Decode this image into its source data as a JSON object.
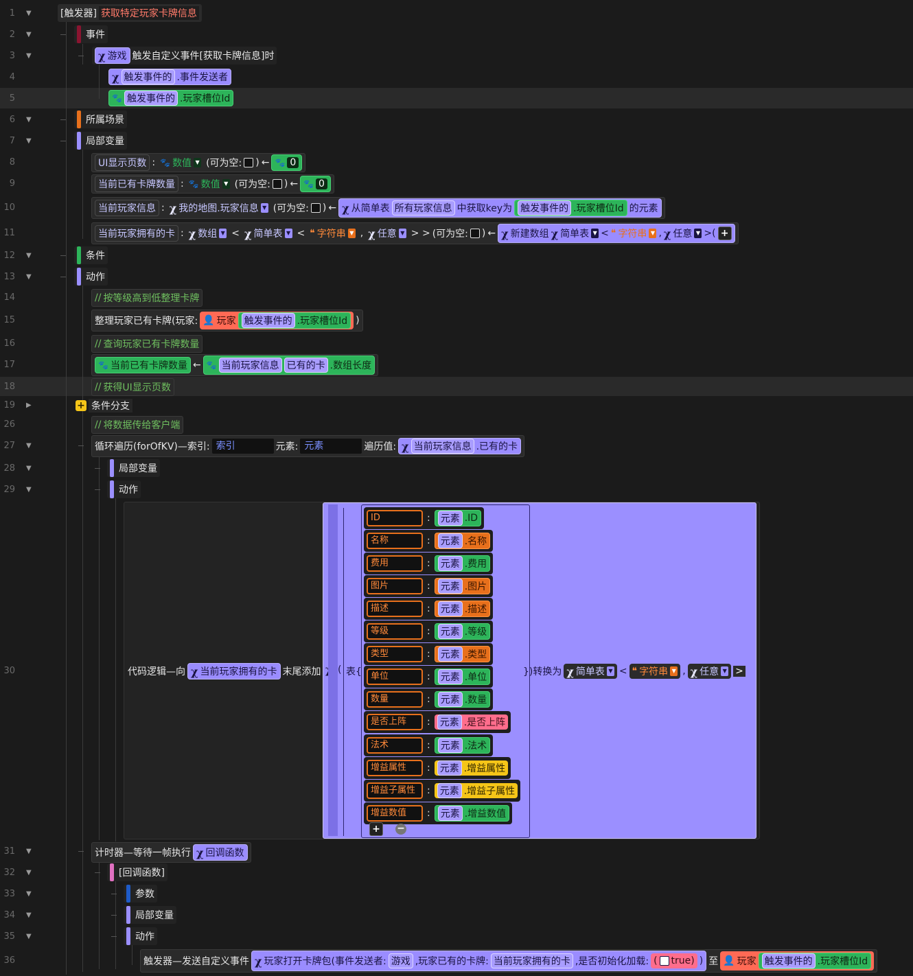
{
  "lines": {
    "l1": {
      "num": "1",
      "prefix": "[触发器]",
      "name": "获取特定玩家卡牌信息"
    },
    "l2": {
      "num": "2",
      "label": "事件"
    },
    "l3": {
      "num": "3",
      "game": "游戏",
      "text": "触发自定义事件[获取卡牌信息]时"
    },
    "l4": {
      "num": "4",
      "a": "触发事件的",
      "b": ".事件发送者"
    },
    "l5": {
      "num": "5",
      "a": "触发事件的",
      "b": ".玩家槽位Id"
    },
    "l6": {
      "num": "6",
      "label": "所属场景"
    },
    "l7": {
      "num": "7",
      "label": "局部变量"
    },
    "l8": {
      "num": "8",
      "var": "UI显示页数",
      "colon": ":",
      "type": "数值",
      "nullable": "(可为空:",
      "close": ")",
      "arrow": "←",
      "value": "0"
    },
    "l9": {
      "num": "9",
      "var": "当前已有卡牌数量",
      "colon": ":",
      "type": "数值",
      "nullable": "(可为空:",
      "close": ")",
      "arrow": "←",
      "value": "0"
    },
    "l10": {
      "num": "10",
      "var": "当前玩家信息",
      "colon": ":",
      "type": "我的地图.玩家信息",
      "nullable": "(可为空:",
      "close": ")",
      "arrow": "←",
      "from": "从简单表",
      "table": "所有玩家信息",
      "get": "中获取key为",
      "a": "触发事件的",
      "b": ".玩家槽位Id",
      "tail": "的元素"
    },
    "l11": {
      "num": "11",
      "var": "当前玩家拥有的卡",
      "colon": ":",
      "type": "数组",
      "lt": "<",
      "simple": "简单表",
      "lt2": "<",
      "str": "字符串",
      "comma": ",",
      "any": "任意",
      "gt": "> >",
      "nullable": "(可为空:",
      "close": ")",
      "arrow": "←",
      "newarr": "新建数组",
      "simple2": "简单表",
      "lt3": "<",
      "str2": "字符串",
      "comma2": ",",
      "any2": "任意",
      "gt2": ">(",
      "plus": "+"
    },
    "l12": {
      "num": "12",
      "label": "条件"
    },
    "l13": {
      "num": "13",
      "label": "动作"
    },
    "l14": {
      "num": "14",
      "comment": "按等级高到低整理卡牌"
    },
    "l15": {
      "num": "15",
      "text": "整理玩家已有卡牌(玩家:",
      "player": "玩家",
      "a": "触发事件的",
      "b": ".玩家槽位Id",
      "close": ")"
    },
    "l16": {
      "num": "16",
      "comment": "查询玩家已有卡牌数量"
    },
    "l17": {
      "num": "17",
      "var": "当前已有卡牌数量",
      "arrow": "←",
      "a": "当前玩家信息",
      "b": "已有的卡",
      "c": ".数组长度"
    },
    "l18": {
      "num": "18",
      "comment": "获得UI显示页数"
    },
    "l19": {
      "num": "19",
      "label": "条件分支"
    },
    "l26": {
      "num": "26",
      "comment": "将数据传给客户端"
    },
    "l27": {
      "num": "27",
      "text": "循环遍历(forOfKV)—索引:",
      "idx": "索引",
      "elem_label": "元素:",
      "elem": "元素",
      "iter": "遍历值:",
      "a": "当前玩家信息",
      "b": ".已有的卡"
    },
    "l28": {
      "num": "28",
      "label": "局部变量"
    },
    "l29": {
      "num": "29",
      "label": "动作"
    },
    "l30": {
      "num": "30",
      "text": "代码逻辑—向",
      "arr": "当前玩家拥有的卡",
      "append": "末尾添加",
      "paren": "(",
      "table": "表{",
      "close": "})转换为",
      "simple": "简单表",
      "lt": "<",
      "str": "字符串",
      "comma": ",",
      "any": "任意",
      "gt": ">"
    },
    "l31": {
      "num": "31",
      "text": "计时器—等待一帧执行",
      "cb": "回调函数"
    },
    "l32": {
      "num": "32",
      "label": "[回调函数]"
    },
    "l33": {
      "num": "33",
      "label": "参数"
    },
    "l34": {
      "num": "34",
      "label": "局部变量"
    },
    "l35": {
      "num": "35",
      "label": "动作"
    },
    "l36": {
      "num": "36",
      "text": "触发器—发送自定义事件",
      "evt": "玩家打开卡牌包(事件发送者:",
      "game": "游戏",
      ",cards": ",玩家已有的卡牌:",
      "arr": "当前玩家拥有的卡",
      "init": ",是否初始化加载:",
      "true": "true)",
      "close": ")",
      "to": "至",
      "player": "玩家",
      "a": "触发事件的",
      "b": ".玩家槽位Id"
    }
  },
  "table_fields": [
    {
      "key": "ID",
      "elem": "元素",
      "field": ".ID",
      "color": "green"
    },
    {
      "key": "名称",
      "elem": "元素",
      "field": ".名称",
      "color": "orange"
    },
    {
      "key": "费用",
      "elem": "元素",
      "field": ".费用",
      "color": "green"
    },
    {
      "key": "图片",
      "elem": "元素",
      "field": ".图片",
      "color": "orange"
    },
    {
      "key": "描述",
      "elem": "元素",
      "field": ".描述",
      "color": "orange"
    },
    {
      "key": "等级",
      "elem": "元素",
      "field": ".等级",
      "color": "green"
    },
    {
      "key": "类型",
      "elem": "元素",
      "field": ".类型",
      "color": "orange"
    },
    {
      "key": "单位",
      "elem": "元素",
      "field": ".单位",
      "color": "green"
    },
    {
      "key": "数量",
      "elem": "元素",
      "field": ".数量",
      "color": "green"
    },
    {
      "key": "是否上阵",
      "elem": "元素",
      "field": ".是否上阵",
      "color": "pink"
    },
    {
      "key": "法术",
      "elem": "元素",
      "field": ".法术",
      "color": "green"
    },
    {
      "key": "增益属性",
      "elem": "元素",
      "field": ".增益属性",
      "color": "yellow"
    },
    {
      "key": "增益子属性",
      "elem": "元素",
      "field": ".增益子属性",
      "color": "yellow"
    },
    {
      "key": "增益数值",
      "elem": "元素",
      "field": ".增益数值",
      "color": "green"
    }
  ],
  "colon": ":",
  "fold_lines": [
    "1",
    "2",
    "3",
    "6",
    "7",
    "12",
    "13",
    "19",
    "27",
    "28",
    "29",
    "31",
    "32",
    "33",
    "34",
    "35"
  ],
  "plain_lines": [
    "4",
    "5",
    "8",
    "9",
    "10",
    "11",
    "14",
    "15",
    "16",
    "17",
    "18",
    "26",
    "30",
    "36"
  ]
}
